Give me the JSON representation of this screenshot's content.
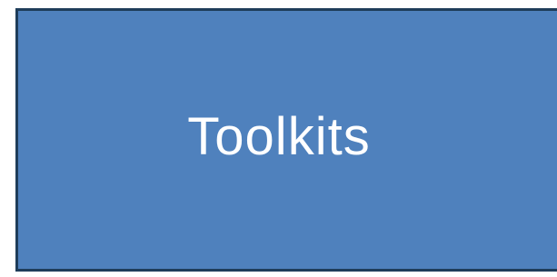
{
  "diagram": {
    "node": {
      "label": "Toolkits",
      "fill_color": "#4f81bd",
      "border_color": "#1f3d5a",
      "text_color": "#ffffff"
    }
  }
}
